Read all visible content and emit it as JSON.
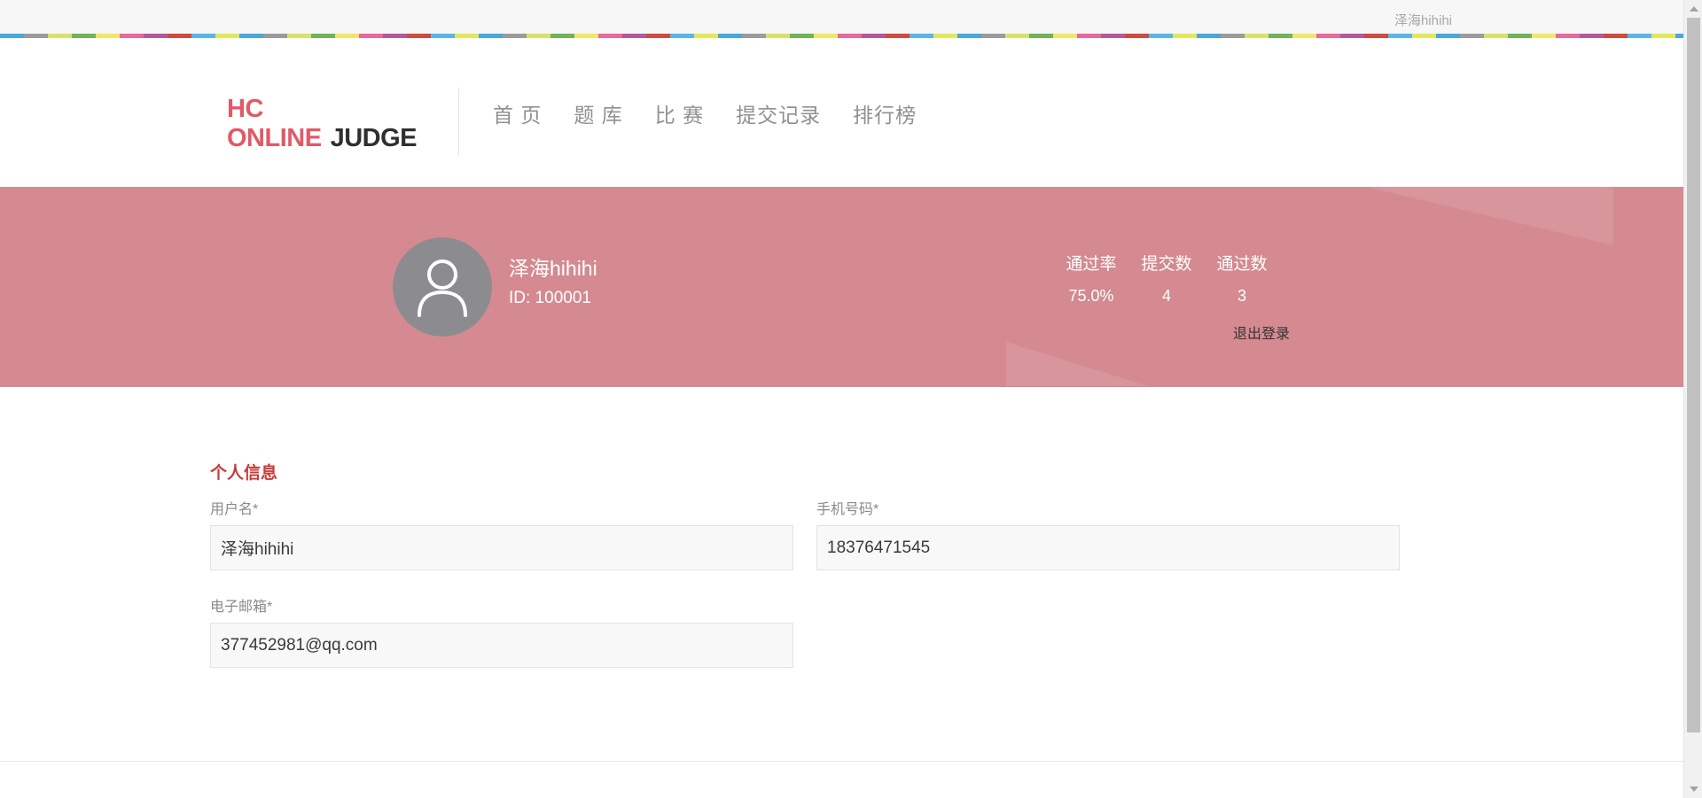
{
  "topbar": {
    "username": "泽海hihihi"
  },
  "logo": {
    "line1": "HC",
    "line2a": "ONLINE",
    "line2b": "JUDGE"
  },
  "nav": {
    "items": [
      {
        "label": "首 页"
      },
      {
        "label": "题 库"
      },
      {
        "label": "比 赛"
      },
      {
        "label": "提交记录"
      },
      {
        "label": "排行榜"
      }
    ]
  },
  "profile": {
    "username": "泽海hihihi",
    "id": "ID: 100001",
    "stats": {
      "pass_rate_label": "通过率",
      "pass_rate": "75.0%",
      "submissions_label": "提交数",
      "submissions": "4",
      "passed_label": "通过数",
      "passed": "3"
    },
    "logout_label": "退出登录"
  },
  "info": {
    "title": "个人信息",
    "username_label": "用户名*",
    "username_value": "泽海hihihi",
    "phone_label": "手机号码*",
    "phone_value": "18376471545",
    "email_label": "电子邮箱*",
    "email_value": "377452981@qq.com"
  },
  "colors": {
    "banner": "#d48a90",
    "brand": "#e05a68",
    "section_title": "#c63b3b"
  }
}
